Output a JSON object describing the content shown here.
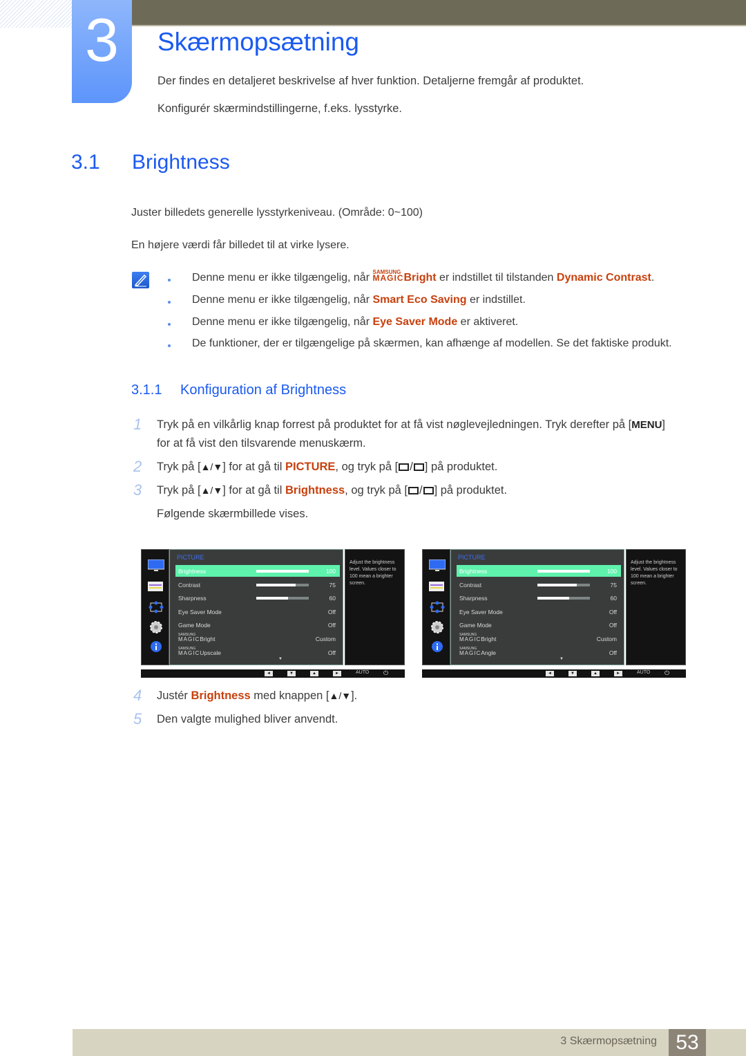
{
  "chapter": {
    "number": "3",
    "title": "Skærmopsætning",
    "intro": [
      "Der findes en detaljeret beskrivelse af hver funktion. Detaljerne fremgår af produktet.",
      "Konfigurér skærmindstillingerne, f.eks. lysstyrke."
    ]
  },
  "section": {
    "number": "3.1",
    "title": "Brightness",
    "paragraphs": [
      "Juster billedets generelle lysstyrkeniveau. (Område: 0~100)",
      "En højere værdi får billedet til at virke lysere."
    ]
  },
  "notes": {
    "icon": "note-pencil-icon",
    "items": [
      {
        "pre": "Denne menu er ikke tilgængelig, når ",
        "magic_top": "SAMSUNG",
        "magic_bottom": "MAGIC",
        "hl1": "Bright",
        "mid": " er indstillet til tilstanden ",
        "hl2": "Dynamic Contrast",
        "post": "."
      },
      {
        "pre": "Denne menu er ikke tilgængelig, når ",
        "hl1": "Smart Eco Saving",
        "post": " er indstillet."
      },
      {
        "pre": "Denne menu er ikke tilgængelig, når ",
        "hl1": "Eye Saver Mode",
        "post": " er aktiveret."
      },
      {
        "pre": "De funktioner, der er tilgængelige på skærmen, kan afhænge af modellen. Se det faktiske produkt."
      }
    ]
  },
  "subsection": {
    "number": "3.1.1",
    "title": "Konfiguration af Brightness"
  },
  "steps": [
    {
      "num": "1",
      "line1_pre": "Tryk på en vilkårlig knap forrest på produktet for at få vist nøglevejledningen. Tryk derefter på [",
      "key": "MENU",
      "line1_post": "]",
      "line2": "for at få vist den tilsvarende menuskærm."
    },
    {
      "num": "2",
      "pre": "Tryk på [",
      "updown": "▲/▼",
      "mid": "] for at gå til ",
      "hl": "PICTURE",
      "post": ", og tryk på [",
      "end": "] på produktet."
    },
    {
      "num": "3",
      "pre": "Tryk på [",
      "updown": "▲/▼",
      "mid": "] for at gå til ",
      "hl": "Brightness",
      "post": ", og tryk på [",
      "end": "] på produktet.",
      "line2": "Følgende skærmbillede vises."
    },
    {
      "num": "4",
      "pre": "Justér ",
      "hl": "Brightness",
      "mid": " med knappen [",
      "updown": "▲/▼",
      "post": "]."
    },
    {
      "num": "5",
      "text": "Den valgte mulighed bliver anvendt."
    }
  ],
  "osd_screens": [
    {
      "menu_title": "PICTURE",
      "help_text": "Adjust the brightness level. Values closer to 100 mean a brighter screen.",
      "rows": [
        {
          "label": "Brightness",
          "value": "100",
          "bar": 100,
          "selected": true
        },
        {
          "label": "Contrast",
          "value": "75",
          "bar": 75
        },
        {
          "label": "Sharpness",
          "value": "60",
          "bar": 60
        },
        {
          "label": "Eye Saver Mode",
          "value": "Off"
        },
        {
          "label": "Game Mode",
          "value": "Off"
        },
        {
          "label": "Bright",
          "magic": true,
          "value": "Custom"
        },
        {
          "label": "Upscale",
          "magic": true,
          "value": "Off"
        }
      ],
      "bottom_buttons": [
        "◄",
        "▼",
        "▲",
        "►"
      ],
      "auto_label": "AUTO",
      "power_icon": "⏻"
    },
    {
      "menu_title": "PICTURE",
      "help_text": "Adjust the brightness level. Values closer to 100 mean a brighter screen.",
      "rows": [
        {
          "label": "Brightness",
          "value": "100",
          "bar": 100,
          "selected": true
        },
        {
          "label": "Contrast",
          "value": "75",
          "bar": 75
        },
        {
          "label": "Sharpness",
          "value": "60",
          "bar": 60
        },
        {
          "label": "Eye Saver Mode",
          "value": "Off"
        },
        {
          "label": "Game Mode",
          "value": "Off"
        },
        {
          "label": "Bright",
          "magic": true,
          "value": "Custom"
        },
        {
          "label": "Angle",
          "magic": true,
          "value": "Off"
        }
      ],
      "bottom_buttons": [
        "◄",
        "▼",
        "▲",
        "►"
      ],
      "auto_label": "AUTO",
      "power_icon": "⏻"
    }
  ],
  "magic": {
    "top": "SAMSUNG",
    "bottom": "MAGIC"
  },
  "footer": {
    "text": "3 Skærmopsætning",
    "page": "53"
  },
  "colors": {
    "accent_blue": "#1a5af0",
    "highlight_orange": "#c7410e",
    "osd_select": "#5ff2ad"
  }
}
